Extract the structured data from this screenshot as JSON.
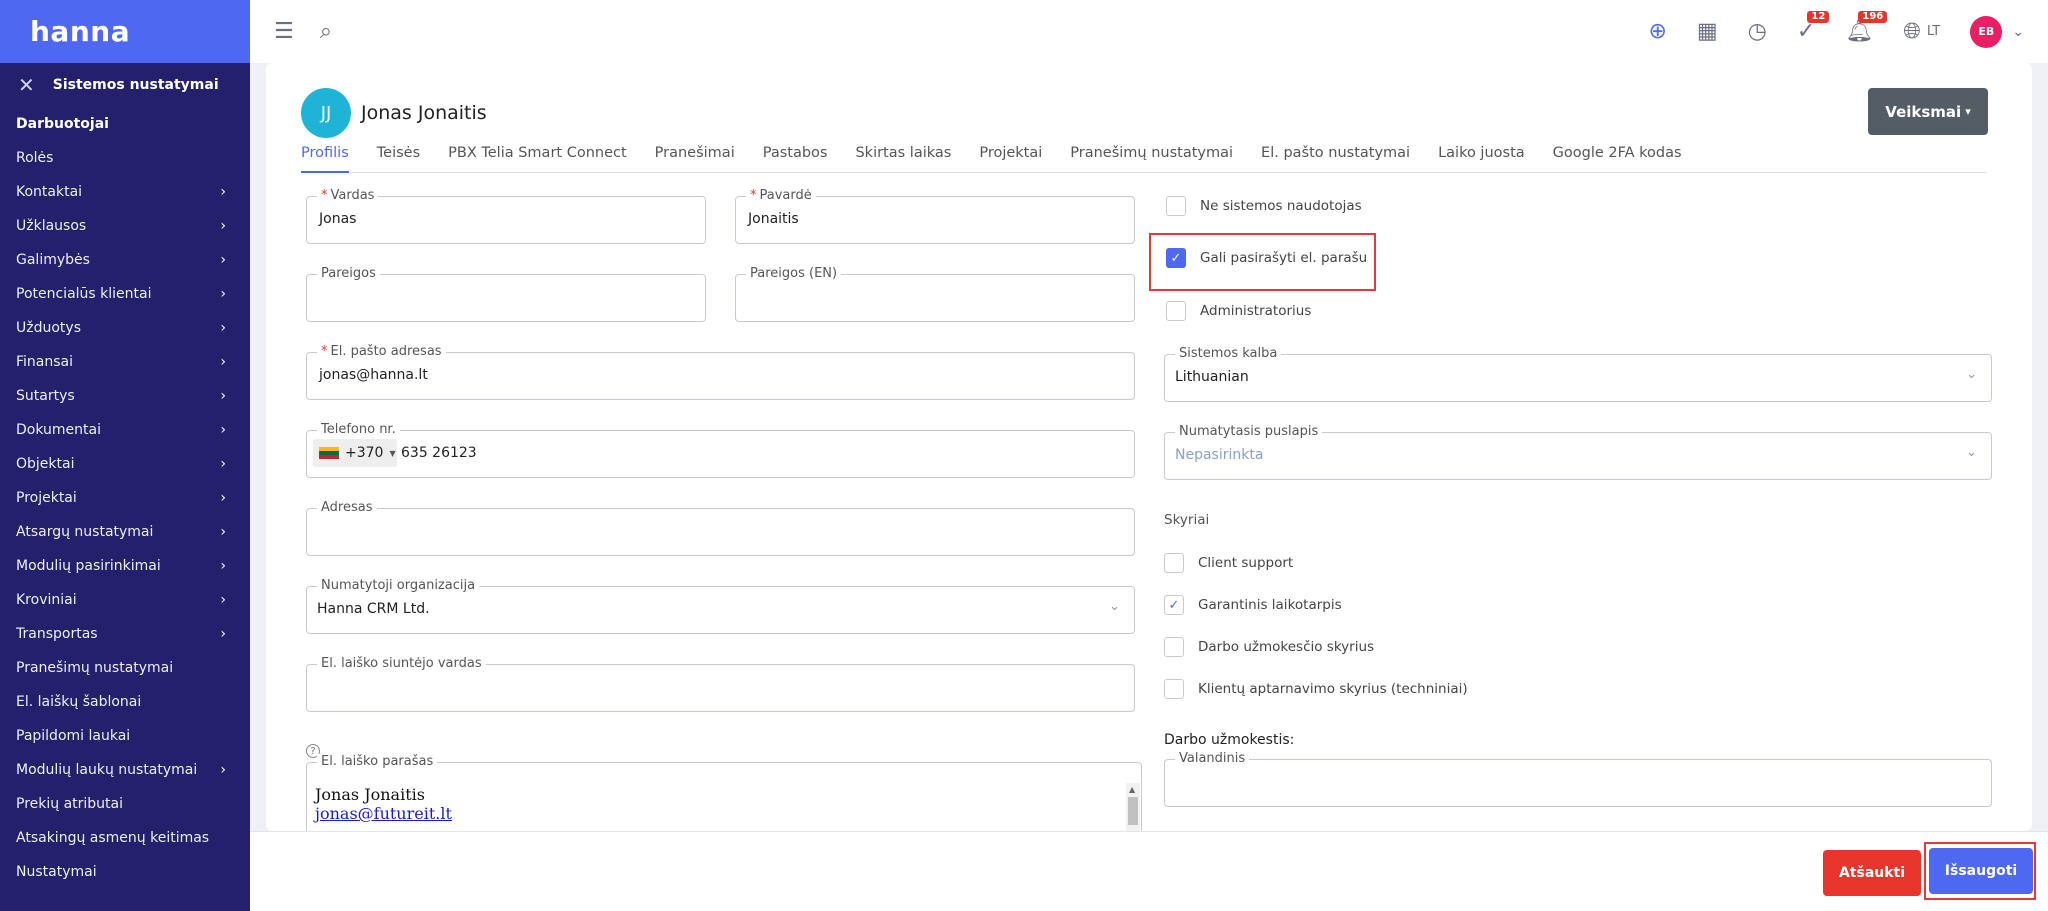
{
  "app": {
    "logo": "hanna"
  },
  "sidebar": {
    "section_title": "Sistemos nustatymai",
    "items": [
      {
        "label": "Darbuotojai",
        "active": true,
        "has_children": false
      },
      {
        "label": "Rolės",
        "has_children": false
      },
      {
        "label": "Kontaktai",
        "has_children": true
      },
      {
        "label": "Užklausos",
        "has_children": true
      },
      {
        "label": "Galimybės",
        "has_children": true
      },
      {
        "label": "Potencialūs klientai",
        "has_children": true
      },
      {
        "label": "Užduotys",
        "has_children": true
      },
      {
        "label": "Finansai",
        "has_children": true
      },
      {
        "label": "Sutartys",
        "has_children": true
      },
      {
        "label": "Dokumentai",
        "has_children": true
      },
      {
        "label": "Objektai",
        "has_children": true
      },
      {
        "label": "Projektai",
        "has_children": true
      },
      {
        "label": "Atsargų nustatymai",
        "has_children": true
      },
      {
        "label": "Modulių pasirinkimai",
        "has_children": true
      },
      {
        "label": "Kroviniai",
        "has_children": true
      },
      {
        "label": "Transportas",
        "has_children": true
      },
      {
        "label": "Pranešimų nustatymai",
        "has_children": false
      },
      {
        "label": "El. laiškų šablonai",
        "has_children": false
      },
      {
        "label": "Papildomi laukai",
        "has_children": false
      },
      {
        "label": "Modulių laukų nustatymai",
        "has_children": true
      },
      {
        "label": "Prekių atributai",
        "has_children": false
      },
      {
        "label": "Atsakingų asmenų keitimas",
        "has_children": false
      },
      {
        "label": "Nustatymai",
        "has_children": false
      }
    ]
  },
  "topbar": {
    "badge_tasks": "12",
    "badge_notifications": "196",
    "language": "LT",
    "user_initials": "EB"
  },
  "profile": {
    "initials": "JJ",
    "name": "Jonas Jonaitis",
    "actions_label": "Veiksmai"
  },
  "tabs": [
    {
      "label": "Profilis",
      "active": true
    },
    {
      "label": "Teisės"
    },
    {
      "label": "PBX Telia Smart Connect"
    },
    {
      "label": "Pranešimai"
    },
    {
      "label": "Pastabos"
    },
    {
      "label": "Skirtas laikas"
    },
    {
      "label": "Projektai"
    },
    {
      "label": "Pranešimų nustatymai"
    },
    {
      "label": "El. pašto nustatymai"
    },
    {
      "label": "Laiko juosta"
    },
    {
      "label": "Google 2FA kodas"
    }
  ],
  "form": {
    "first_name": {
      "label": "Vardas",
      "value": "Jonas",
      "required": "*"
    },
    "last_name": {
      "label": "Pavardė",
      "value": "Jonaitis",
      "required": "*"
    },
    "position": {
      "label": "Pareigos",
      "value": ""
    },
    "position_en": {
      "label": "Pareigos (EN)",
      "value": ""
    },
    "email": {
      "label": "El. pašto adresas",
      "value": "jonas@hanna.lt",
      "required": "*"
    },
    "phone": {
      "label": "Telefono nr.",
      "code": "+370",
      "value": "635 26123"
    },
    "address": {
      "label": "Adresas",
      "value": ""
    },
    "organization": {
      "label": "Numatytoji organizacija",
      "value": "Hanna CRM Ltd."
    },
    "sender_name": {
      "label": "El. laiško siuntėjo vardas",
      "value": ""
    },
    "signature": {
      "label": "El. laiško parašas",
      "line1": "Jonas Jonaitis",
      "line2": "jonas@futureit.lt"
    },
    "not_system_user": {
      "label": "Ne sistemos naudotojas",
      "checked": false
    },
    "can_sign": {
      "label": "Gali pasirašyti el. parašu",
      "checked": true
    },
    "administrator": {
      "label": "Administratorius",
      "checked": false
    },
    "system_language": {
      "label": "Sistemos kalba",
      "value": "Lithuanian"
    },
    "default_page": {
      "label": "Numatytasis puslapis",
      "placeholder": "Nepasirinkta"
    },
    "departments_label": "Skyriai",
    "departments": [
      {
        "label": "Client support",
        "checked": false
      },
      {
        "label": "Garantinis laikotarpis",
        "checked": true
      },
      {
        "label": "Darbo užmokesčio skyrius",
        "checked": false
      },
      {
        "label": "Klientų aptarnavimo skyrius (techniniai)",
        "checked": false
      }
    ],
    "salary_label": "Darbo užmokestis:",
    "hourly": {
      "label": "Valandinis",
      "value": ""
    }
  },
  "footer": {
    "cancel_label": "Atšaukti",
    "save_label": "Išsaugoti"
  },
  "colors": {
    "accent": "#4f68f2",
    "sidebar_bg": "#24206c",
    "danger": "#e8352b",
    "avatar": "#1fb4d6",
    "user_avatar": "#e91e63",
    "actions_btn": "#545d66"
  }
}
